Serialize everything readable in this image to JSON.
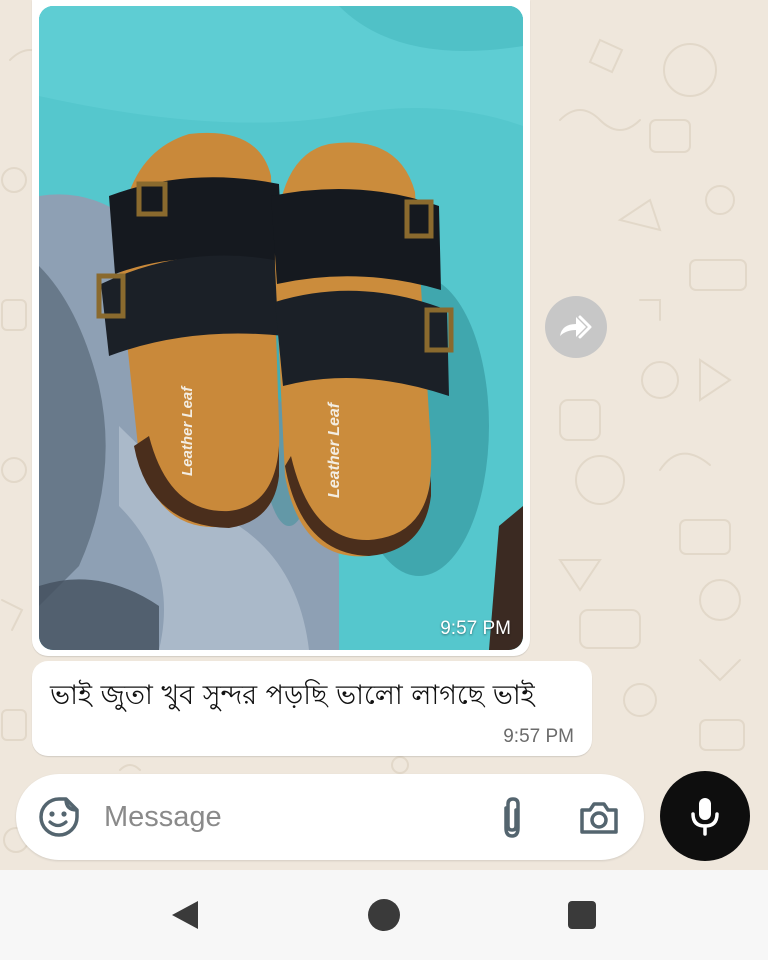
{
  "theme": {
    "chat_background": "#efe7dc",
    "bubble_background": "#ffffff",
    "mic_button_color": "#0e0e0e",
    "photo_background_teal": "#53c5cc",
    "sole_color": "#c98a3a",
    "strap_color": "#15191f"
  },
  "messages": [
    {
      "type": "image",
      "photo_subject": "pair of black two-strap slide sandals with tan footbeds",
      "footbed_print": "Leather Leaf",
      "time": "9:57 PM"
    },
    {
      "type": "text",
      "text": "ভাই জুতা খুব সুন্দর পড়ছি ভালো লাগছে ভাই",
      "time": "9:57 PM"
    }
  ],
  "composer": {
    "placeholder": "Message",
    "value": "",
    "icons": [
      "sticker-icon",
      "paperclip-icon",
      "camera-icon",
      "microphone-icon"
    ]
  },
  "forward": {
    "icon": "forward-icon"
  },
  "nav": {
    "icons": [
      "back-triangle-icon",
      "home-circle-icon",
      "recents-square-icon"
    ]
  }
}
